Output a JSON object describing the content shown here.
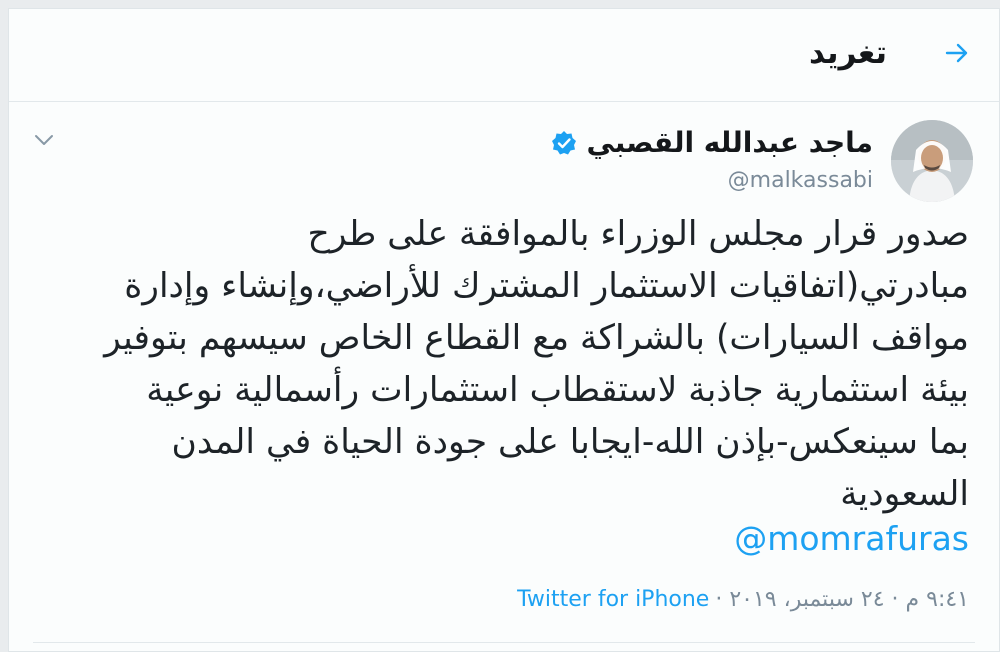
{
  "header": {
    "title": "تغريد",
    "back_icon": "arrow-right-icon"
  },
  "tweet": {
    "display_name": "ماجد عبدالله القصبي",
    "verified_icon": "verified-badge-icon",
    "handle": "@malkassabi",
    "menu_icon": "chevron-down-icon",
    "text_lines": [
      "صدور قرار مجلس الوزراء بالموافقة على طرح",
      "مبادرتي(اتفاقيات الاستثمار المشترك للأراضي،وإنشاء وإدارة",
      "مواقف السيارات) بالشراكة مع القطاع الخاص سيسهم بتوفير",
      "بيئة استثمارية جاذبة لاستقطاب استثمارات رأسمالية نوعية",
      "بما سينعكس-بإذن الله-ايجابا على جودة الحياة في المدن",
      "السعودية"
    ],
    "mention": "@momrafuras",
    "timestamp": "٩:٤١ م · ٢٤ سبتمبر، ٢٠١٩ ·",
    "source": "Twitter for iPhone"
  },
  "colors": {
    "accent": "#1da1f2",
    "text": "#14171a",
    "secondary": "#7a8a98"
  }
}
